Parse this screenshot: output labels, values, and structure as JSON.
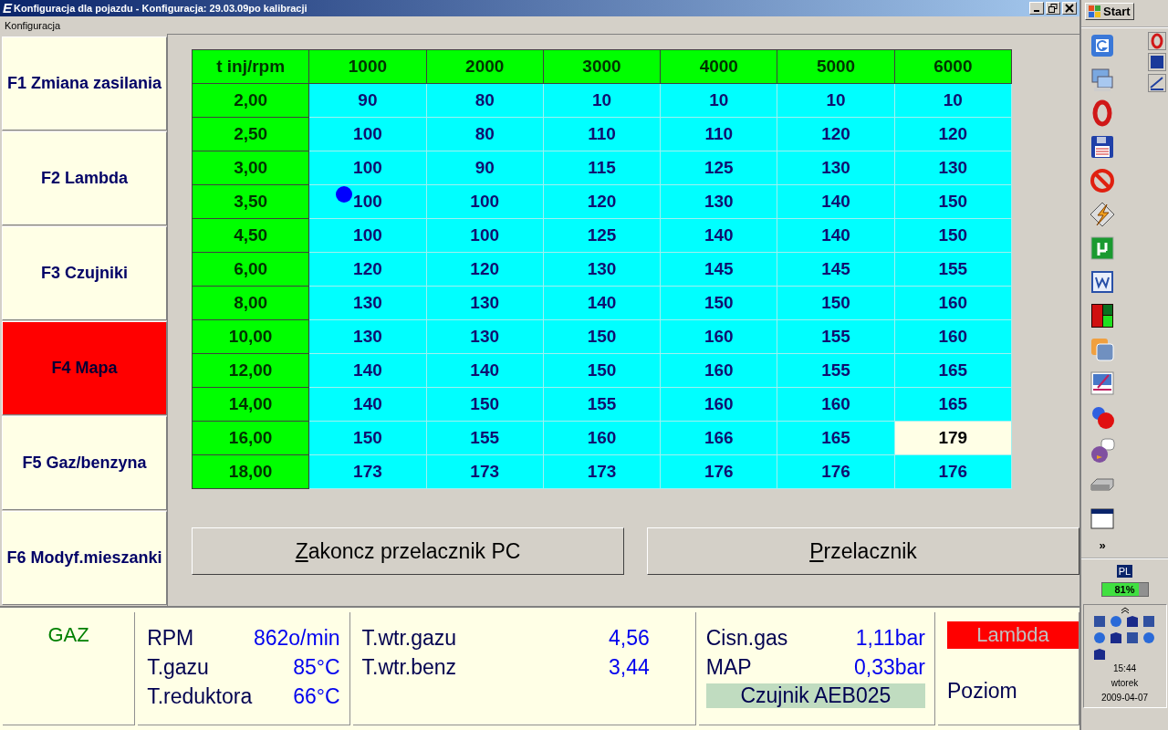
{
  "window": {
    "title": "Konfiguracja dla pojazdu - Konfiguracja: 29.03.09po kalibracji",
    "app_letter": "E"
  },
  "menu": [
    "Konfiguracja"
  ],
  "nav": [
    {
      "label": "F1 Zmiana zasilania",
      "selected": false
    },
    {
      "label": "F2 Lambda",
      "selected": false
    },
    {
      "label": "F3 Czujniki",
      "selected": false
    },
    {
      "label": "F4 Mapa",
      "selected": true
    },
    {
      "label": "F5 Gaz/benzyna",
      "selected": false
    },
    {
      "label": "F6 Modyf.mieszanki",
      "selected": false
    }
  ],
  "map_table": {
    "corner": "t inj/rpm",
    "columns": [
      "1000",
      "2000",
      "3000",
      "4000",
      "5000",
      "6000"
    ],
    "rows": [
      {
        "label": "2,00",
        "cells": [
          {
            "value": "90",
            "selected": false
          },
          {
            "value": "80",
            "selected": false
          },
          {
            "value": "10",
            "selected": false
          },
          {
            "value": "10",
            "selected": false
          },
          {
            "value": "10",
            "selected": false
          },
          {
            "value": "10",
            "selected": false
          }
        ]
      },
      {
        "label": "2,50",
        "cells": [
          {
            "value": "100",
            "selected": false
          },
          {
            "value": "80",
            "selected": false
          },
          {
            "value": "110",
            "selected": false
          },
          {
            "value": "110",
            "selected": false
          },
          {
            "value": "120",
            "selected": false
          },
          {
            "value": "120",
            "selected": false
          }
        ]
      },
      {
        "label": "3,00",
        "cells": [
          {
            "value": "100",
            "selected": false
          },
          {
            "value": "90",
            "selected": false
          },
          {
            "value": "115",
            "selected": false
          },
          {
            "value": "125",
            "selected": false
          },
          {
            "value": "130",
            "selected": false
          },
          {
            "value": "130",
            "selected": false
          }
        ]
      },
      {
        "label": "3,50",
        "cells": [
          {
            "value": "100",
            "selected": false,
            "cursor": true
          },
          {
            "value": "100",
            "selected": false
          },
          {
            "value": "120",
            "selected": false
          },
          {
            "value": "130",
            "selected": false
          },
          {
            "value": "140",
            "selected": false
          },
          {
            "value": "150",
            "selected": false
          }
        ]
      },
      {
        "label": "4,50",
        "cells": [
          {
            "value": "100",
            "selected": false
          },
          {
            "value": "100",
            "selected": false
          },
          {
            "value": "125",
            "selected": false
          },
          {
            "value": "140",
            "selected": false
          },
          {
            "value": "140",
            "selected": false
          },
          {
            "value": "150",
            "selected": false
          }
        ]
      },
      {
        "label": "6,00",
        "cells": [
          {
            "value": "120",
            "selected": false
          },
          {
            "value": "120",
            "selected": false
          },
          {
            "value": "130",
            "selected": false
          },
          {
            "value": "145",
            "selected": false
          },
          {
            "value": "145",
            "selected": false
          },
          {
            "value": "155",
            "selected": false
          }
        ]
      },
      {
        "label": "8,00",
        "cells": [
          {
            "value": "130",
            "selected": false
          },
          {
            "value": "130",
            "selected": false
          },
          {
            "value": "140",
            "selected": false
          },
          {
            "value": "150",
            "selected": false
          },
          {
            "value": "150",
            "selected": false
          },
          {
            "value": "160",
            "selected": false
          }
        ]
      },
      {
        "label": "10,00",
        "cells": [
          {
            "value": "130",
            "selected": false
          },
          {
            "value": "130",
            "selected": false
          },
          {
            "value": "150",
            "selected": false
          },
          {
            "value": "160",
            "selected": false
          },
          {
            "value": "155",
            "selected": false
          },
          {
            "value": "160",
            "selected": false
          }
        ]
      },
      {
        "label": "12,00",
        "cells": [
          {
            "value": "140",
            "selected": false
          },
          {
            "value": "140",
            "selected": false
          },
          {
            "value": "150",
            "selected": false
          },
          {
            "value": "160",
            "selected": false
          },
          {
            "value": "155",
            "selected": false
          },
          {
            "value": "165",
            "selected": false
          }
        ]
      },
      {
        "label": "14,00",
        "cells": [
          {
            "value": "140",
            "selected": false
          },
          {
            "value": "150",
            "selected": false
          },
          {
            "value": "155",
            "selected": false
          },
          {
            "value": "160",
            "selected": false
          },
          {
            "value": "160",
            "selected": false
          },
          {
            "value": "165",
            "selected": false
          }
        ]
      },
      {
        "label": "16,00",
        "cells": [
          {
            "value": "150",
            "selected": false
          },
          {
            "value": "155",
            "selected": false
          },
          {
            "value": "160",
            "selected": false
          },
          {
            "value": "166",
            "selected": false
          },
          {
            "value": "165",
            "selected": false
          },
          {
            "value": "179",
            "selected": true
          }
        ]
      },
      {
        "label": "18,00",
        "cells": [
          {
            "value": "173",
            "selected": false
          },
          {
            "value": "173",
            "selected": false
          },
          {
            "value": "173",
            "selected": false
          },
          {
            "value": "176",
            "selected": false
          },
          {
            "value": "176",
            "selected": false
          },
          {
            "value": "176",
            "selected": false
          }
        ]
      }
    ]
  },
  "buttons": [
    "Zakoncz przelacznik PC",
    "Przelacznik"
  ],
  "status": {
    "mode": "GAZ",
    "engine": [
      {
        "label": "RPM",
        "value": "862o/min"
      },
      {
        "label": "T.gazu",
        "value": "85°C"
      },
      {
        "label": "T.reduktora",
        "value": "66°C"
      }
    ],
    "injection": [
      {
        "label": "T.wtr.gazu",
        "value": "4,56"
      },
      {
        "label": "T.wtr.benz",
        "value": "3,44"
      }
    ],
    "pressure": [
      {
        "label": "Cisn.gas",
        "value": "1,11bar"
      },
      {
        "label": "MAP",
        "value": "0,33bar"
      }
    ],
    "sensor": "Czujnik AEB025",
    "lambda": "Lambda",
    "level_label": "Poziom"
  },
  "taskbar": {
    "start": "Start",
    "more": "»",
    "language": "PL",
    "battery": {
      "level": 0.81,
      "text": "81%"
    },
    "time": "15:44",
    "day": "wtorek",
    "date": "2009-04-07"
  }
}
